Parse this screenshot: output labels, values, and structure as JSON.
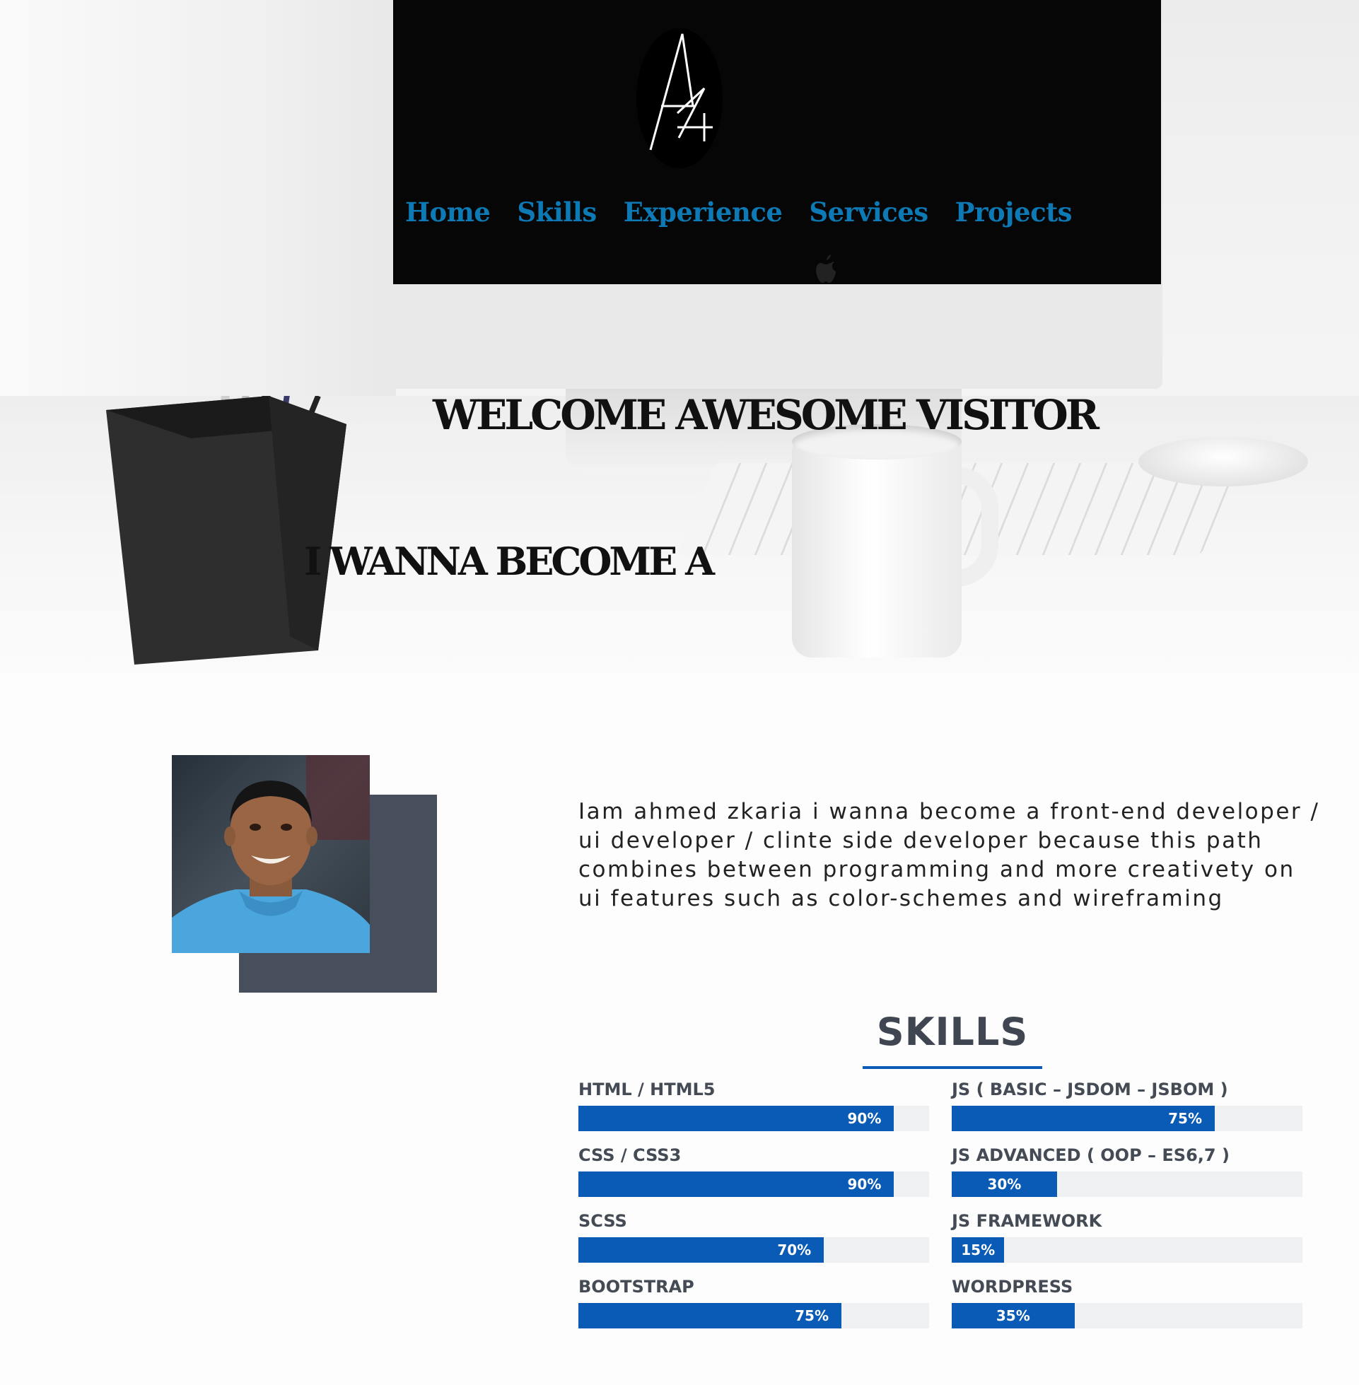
{
  "nav": {
    "items": [
      {
        "label": "Home"
      },
      {
        "label": "Skills"
      },
      {
        "label": "Experience"
      },
      {
        "label": "Services"
      },
      {
        "label": "Projects"
      }
    ]
  },
  "hero": {
    "welcome": "WELCOME AWESOME VISITOR",
    "become": "I WANNA BECOME A"
  },
  "about": {
    "bio": "Iam ahmed zkaria i wanna become a front-end developer / ui developer / clinte side developer because this path combines between programming and more creativety on ui features such as color-schemes and wireframing"
  },
  "skills": {
    "title": "SKILLS",
    "left": [
      {
        "label": "HTML / HTML5",
        "percent": 90,
        "percent_text": "90%"
      },
      {
        "label": "CSS / CSS3",
        "percent": 90,
        "percent_text": "90%"
      },
      {
        "label": "SCSS",
        "percent": 70,
        "percent_text": "70%"
      },
      {
        "label": "BOOTSTRAP",
        "percent": 75,
        "percent_text": "75%"
      }
    ],
    "right": [
      {
        "label": "JS ( BASIC – JSDOM – JSBOM )",
        "percent": 75,
        "percent_text": "75%"
      },
      {
        "label": "JS ADVANCED ( OOP – ES6,7 )",
        "percent": 30,
        "percent_text": "30%"
      },
      {
        "label": "JS FRAMEWORK",
        "percent": 15,
        "percent_text": "15%"
      },
      {
        "label": "WORDPRESS",
        "percent": 35,
        "percent_text": "35%"
      }
    ]
  },
  "colors": {
    "nav_link": "#0d79b5",
    "bar_fill": "#0a5bb5",
    "bar_track": "#eef0f2",
    "photo_back": "#464f5b"
  }
}
